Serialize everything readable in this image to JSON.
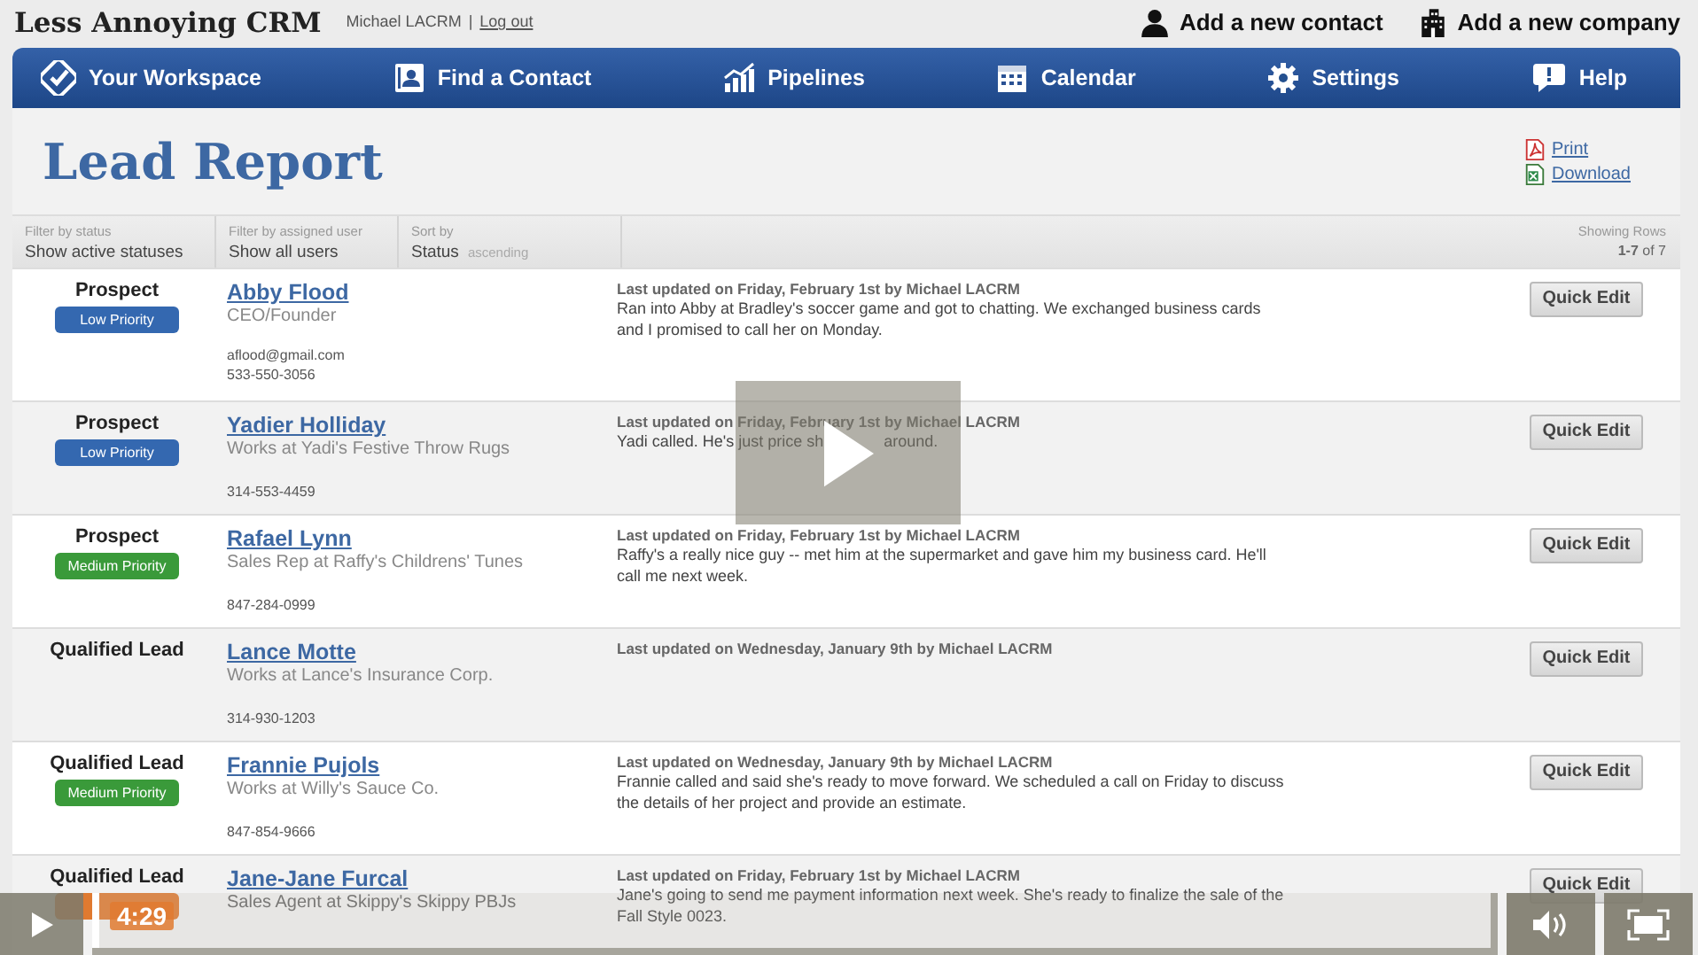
{
  "header": {
    "app_name": "Less Annoying CRM",
    "user": "Michael LACRM",
    "separator": "|",
    "logout": "Log out",
    "actions": [
      {
        "label": "Add a new contact"
      },
      {
        "label": "Add a new company"
      }
    ]
  },
  "nav": [
    {
      "label": "Your Workspace"
    },
    {
      "label": "Find a Contact"
    },
    {
      "label": "Pipelines"
    },
    {
      "label": "Calendar"
    },
    {
      "label": "Settings"
    },
    {
      "label": "Help"
    }
  ],
  "report": {
    "title": "Lead Report",
    "links": [
      {
        "label": "Print"
      },
      {
        "label": "Download"
      }
    ],
    "filters": [
      {
        "label": "Filter by status",
        "value": "Show active statuses"
      },
      {
        "label": "Filter by assigned user",
        "value": "Show all users"
      },
      {
        "label": "Sort by",
        "value": "Status",
        "note": "ascending"
      }
    ],
    "showing": {
      "label": "Showing Rows",
      "range": "1-7",
      "total": "of 7"
    },
    "rows": [
      {
        "status": "Prospect",
        "priority": {
          "label": "Low Priority",
          "kind": "low"
        },
        "name": "Abby Flood",
        "subtitle": "CEO/Founder",
        "email": "aflood@gmail.com",
        "phone": "533-550-3056",
        "updated": "Last updated on Friday, February 1st by Michael LACRM",
        "note": "Ran into Abby at Bradley's soccer game and got to chatting. We exchanged business cards and I promised to call her on Monday.",
        "button": "Quick Edit"
      },
      {
        "status": "Prospect",
        "priority": {
          "label": "Low Priority",
          "kind": "low"
        },
        "name": "Yadier Holliday",
        "subtitle": "Works at Yadi's Festive Throw Rugs",
        "phone": "314-553-4459",
        "updated": "Last updated on Friday, February 1st by Michael LACRM",
        "note": "Yadi called. He's just price sh",
        "note_after": "around.",
        "button": "Quick Edit"
      },
      {
        "status": "Prospect",
        "priority": {
          "label": "Medium Priority",
          "kind": "medium"
        },
        "name": "Rafael Lynn",
        "subtitle": "Sales Rep at Raffy's Childrens' Tunes",
        "phone": "847-284-0999",
        "updated": "Last updated on Friday, February 1st by Michael LACRM",
        "note": "Raffy's a really nice guy -- met him at the supermarket and gave him my business card. He'll call me next week.",
        "button": "Quick Edit"
      },
      {
        "status": "Qualified Lead",
        "name": "Lance Motte",
        "subtitle": "Works at Lance's Insurance Corp.",
        "phone": "314-930-1203",
        "updated": "Last updated on Wednesday, January 9th by Michael LACRM",
        "button": "Quick Edit"
      },
      {
        "status": "Qualified Lead",
        "priority": {
          "label": "Medium Priority",
          "kind": "medium"
        },
        "name": "Frannie Pujols",
        "subtitle": "Works at Willy's Sauce Co.",
        "phone": "847-854-9666",
        "updated": "Last updated on Wednesday, January 9th by Michael LACRM",
        "note": "Frannie called and said she's ready to move forward. We scheduled a call on Friday to discuss the details of her project and provide an estimate.",
        "button": "Quick Edit"
      },
      {
        "status": "Qualified Lead",
        "priority": {
          "kind": "high"
        },
        "name": "Jane-Jane Furcal",
        "subtitle": "Sales Agent at Skippy's Skippy PBJs",
        "updated": "Last updated on Friday, February 1st by Michael LACRM",
        "note": "Jane's going to send me payment information next week. She's ready to finalize the sale of the Fall Style 0023.",
        "button": "Quick Edit"
      }
    ]
  },
  "player": {
    "time": "4:29"
  }
}
